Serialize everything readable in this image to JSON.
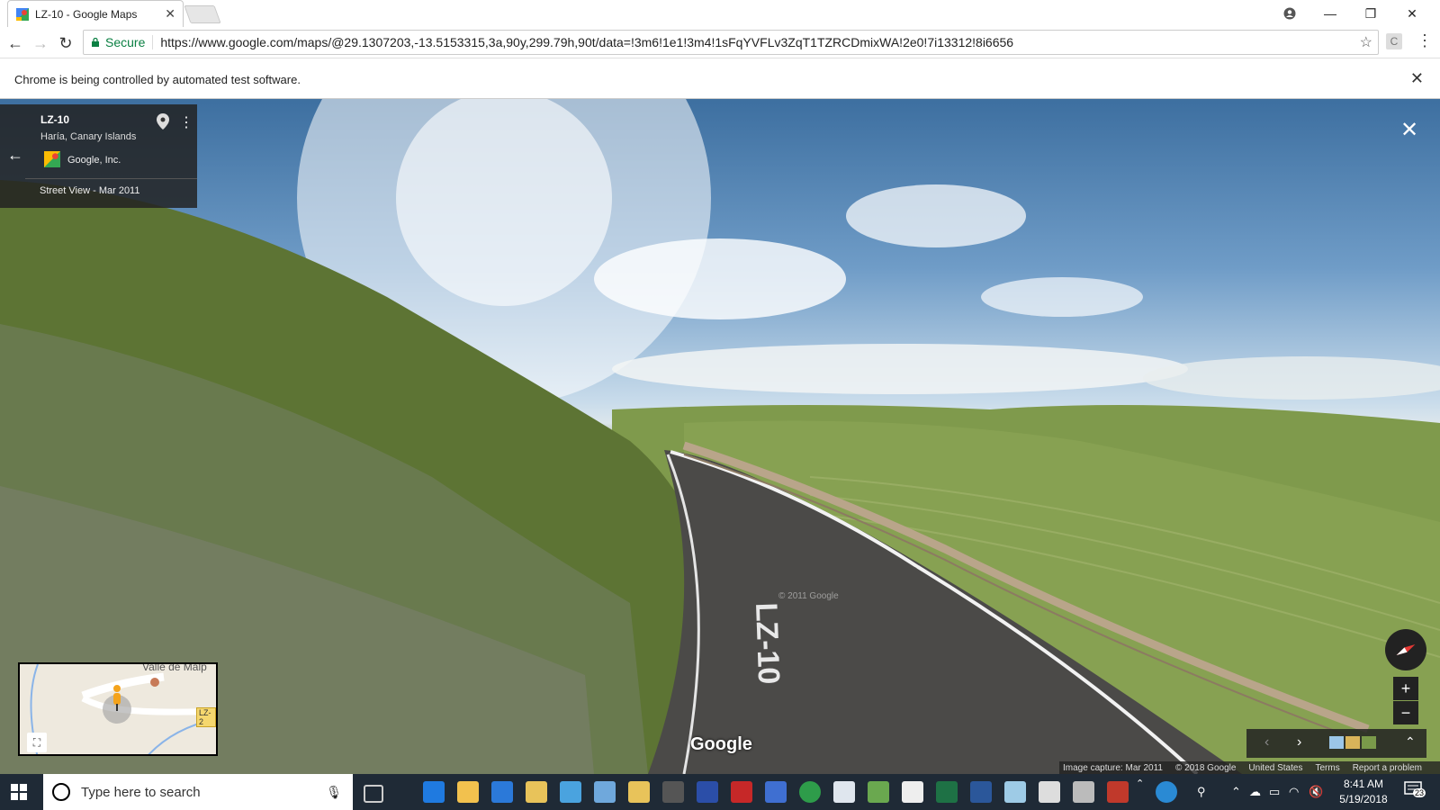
{
  "browser": {
    "tab_title": "LZ-10 - Google Maps",
    "secure_label": "Secure",
    "url": "https://www.google.com/maps/@29.1307203,-13.5153315,3a,90y,299.79h,90t/data=!3m6!1e1!3m4!1sFqYVFLv3ZqT1TZRCDmixWA!2e0!7i13312!8i6656",
    "infobar_message": "Chrome is being controlled by automated test software.",
    "extension_label": "C"
  },
  "streetview": {
    "location_name": "LZ-10",
    "location_sub": "Haría, Canary Islands",
    "owner": "Google, Inc.",
    "capture_label": "Street View - Mar 2011",
    "road_marking": "LZ-10",
    "watermark": "© 2011 Google",
    "logo_text": "Google",
    "minimap_label": "Valle de Malp",
    "minimap_road": "LZ-2",
    "footer": {
      "capture": "Image capture: Mar 2011",
      "copyright": "© 2018 Google",
      "region": "United States",
      "terms": "Terms",
      "report": "Report a problem"
    }
  },
  "taskbar": {
    "search_placeholder": "Type here to search",
    "time": "8:41 AM",
    "date": "5/19/2018",
    "notification_count": "23"
  }
}
